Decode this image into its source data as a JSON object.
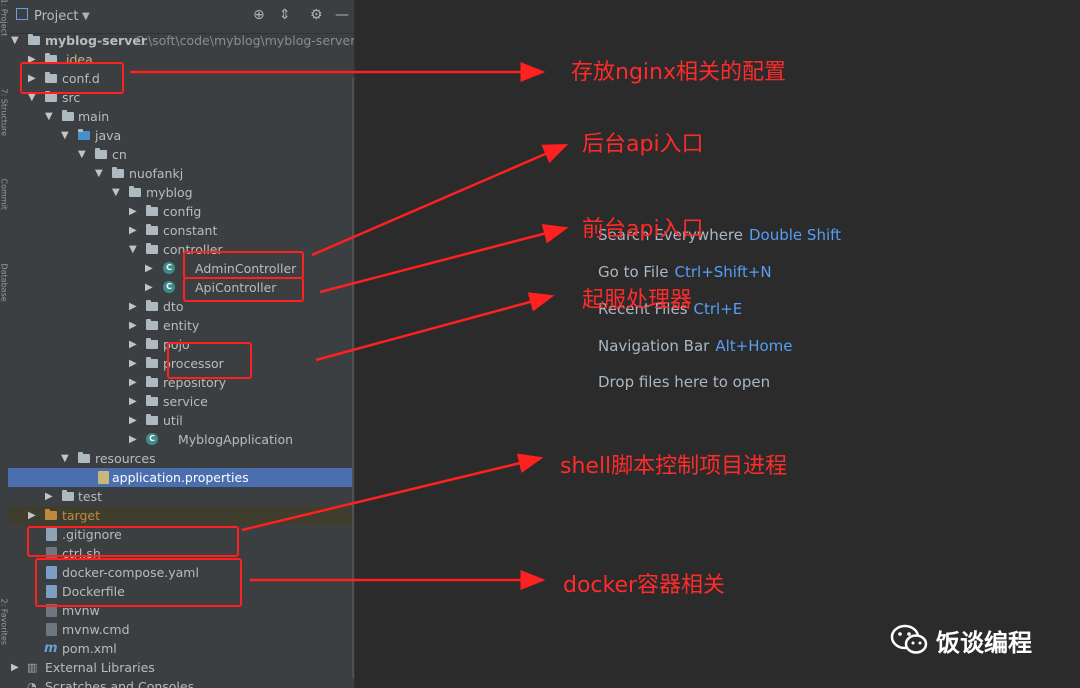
{
  "toolbar": {
    "title": "Project",
    "dropdown_icon": "chevron-down-icon"
  },
  "tree": {
    "root": {
      "name": "myblog-server",
      "path": "C:\\soft\\code\\myblog\\myblog-server"
    },
    "rows": [
      {
        "label": ".idea"
      },
      {
        "label": "conf.d"
      },
      {
        "label": "src"
      },
      {
        "label": "main"
      },
      {
        "label": "java"
      },
      {
        "label": "cn"
      },
      {
        "label": "nuofankj"
      },
      {
        "label": "myblog"
      },
      {
        "label": "config"
      },
      {
        "label": "constant"
      },
      {
        "label": "controller"
      },
      {
        "label": "AdminController"
      },
      {
        "label": "ApiController"
      },
      {
        "label": "dto"
      },
      {
        "label": "entity"
      },
      {
        "label": "pojo"
      },
      {
        "label": "processor"
      },
      {
        "label": "repository"
      },
      {
        "label": "service"
      },
      {
        "label": "util"
      },
      {
        "label": "MyblogApplication"
      },
      {
        "label": "resources"
      },
      {
        "label": "application.properties"
      },
      {
        "label": "test"
      },
      {
        "label": "target"
      },
      {
        "label": ".gitignore"
      },
      {
        "label": "ctrl.sh"
      },
      {
        "label": "docker-compose.yaml"
      },
      {
        "label": "Dockerfile"
      },
      {
        "label": "mvnw"
      },
      {
        "label": "mvnw.cmd"
      },
      {
        "label": "pom.xml"
      },
      {
        "label": "External Libraries"
      },
      {
        "label": "Scratches and Consoles"
      }
    ]
  },
  "side_tabs": [
    "1: Project",
    "7: Structure",
    "Commit",
    "Database",
    "2: Favorites"
  ],
  "editor_hints": [
    {
      "text": "Search Everywhere",
      "key": "Double Shift"
    },
    {
      "text": "Go to File",
      "key": "Ctrl+Shift+N"
    },
    {
      "text": "Recent Files",
      "key": "Ctrl+E"
    },
    {
      "text": "Navigation Bar",
      "key": "Alt+Home"
    },
    {
      "text": "Drop files here to open",
      "key": ""
    }
  ],
  "annotations": [
    {
      "text": "存放nginx相关的配置"
    },
    {
      "text": "后台api入口"
    },
    {
      "text": "前台api入口"
    },
    {
      "text": "起服处理器"
    },
    {
      "text": "shell脚本控制项目进程"
    },
    {
      "text": "docker容器相关"
    }
  ],
  "brand": {
    "text": "饭谈编程",
    "icon": "wechat-icon"
  },
  "colors": {
    "annotation": "#ff2b2b",
    "selection": "#4b6eaf",
    "key": "#589df6"
  }
}
